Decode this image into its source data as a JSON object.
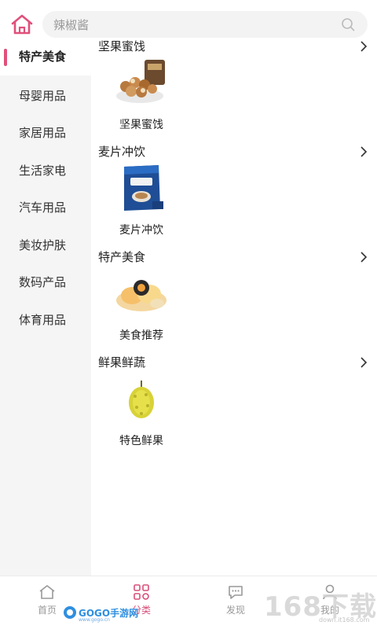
{
  "search": {
    "placeholder": "辣椒酱"
  },
  "sidebar": {
    "items": [
      {
        "label": "特产美食",
        "active": true
      },
      {
        "label": "母婴用品",
        "active": false
      },
      {
        "label": "家居用品",
        "active": false
      },
      {
        "label": "生活家电",
        "active": false
      },
      {
        "label": "汽车用品",
        "active": false
      },
      {
        "label": "美妆护肤",
        "active": false
      },
      {
        "label": "数码产品",
        "active": false
      },
      {
        "label": "体育用品",
        "active": false
      }
    ]
  },
  "sections": [
    {
      "title": "坚果蜜饯",
      "items": [
        {
          "label": "坚果蜜饯",
          "image": "nuts-image"
        }
      ]
    },
    {
      "title": "麦片冲饮",
      "items": [
        {
          "label": "麦片冲饮",
          "image": "coffee-pack-image"
        }
      ]
    },
    {
      "title": "特产美食",
      "items": [
        {
          "label": "美食推荐",
          "image": "pastry-image"
        }
      ]
    },
    {
      "title": "鲜果鲜蔬",
      "items": [
        {
          "label": "特色鲜果",
          "image": "durian-image"
        }
      ]
    }
  ],
  "tabbar": {
    "tabs": [
      {
        "label": "首页",
        "icon": "home-icon",
        "active": false
      },
      {
        "label": "分类",
        "icon": "grid-icon",
        "active": true
      },
      {
        "label": "发现",
        "icon": "chat-icon",
        "active": false
      },
      {
        "label": "我的",
        "icon": "user-icon",
        "active": false
      }
    ]
  },
  "colors": {
    "accent": "#d9507a",
    "sidebar_bg": "#f5f5f5",
    "text": "#222222",
    "muted": "#999999"
  },
  "watermarks": {
    "left_text": "GOGO手游网",
    "left_sub": "www.gogo.cn",
    "right_text": "168下载",
    "right_sub": "down.it168.com"
  }
}
